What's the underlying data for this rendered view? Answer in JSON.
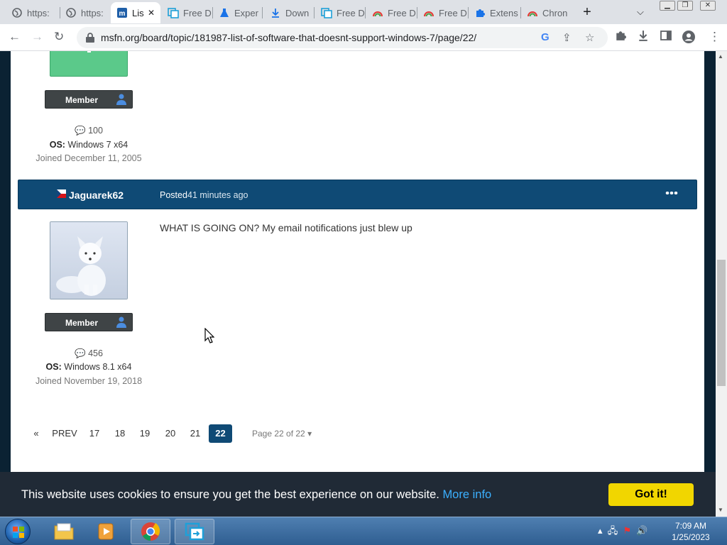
{
  "browser": {
    "tabs": [
      {
        "title": "https:",
        "icon": "globe-icon"
      },
      {
        "title": "https:",
        "icon": "globe-icon"
      },
      {
        "title": "Lis",
        "icon": "msfn-icon",
        "active": true
      },
      {
        "title": "Free D",
        "icon": "copy-icon"
      },
      {
        "title": "Exper",
        "icon": "flask-icon"
      },
      {
        "title": "Down",
        "icon": "download-icon"
      },
      {
        "title": "Free D",
        "icon": "copy-icon"
      },
      {
        "title": "Free D",
        "icon": "rainbow-icon"
      },
      {
        "title": "Free D",
        "icon": "rainbow-icon"
      },
      {
        "title": "Extens",
        "icon": "puzzle-icon"
      },
      {
        "title": "Chron",
        "icon": "rainbow-icon"
      }
    ],
    "url": "msfn.org/board/topic/181987-list-of-software-that-doesnt-support-windows-7/page/22/"
  },
  "prev_post": {
    "rank": "Member",
    "posts": "100",
    "os_label": "OS:",
    "os_value": "Windows 7 x64",
    "joined": "Joined December 11, 2005"
  },
  "post": {
    "author": "Jaguarek62",
    "posted_label": "Posted",
    "posted_time": "41 minutes ago",
    "content": "WHAT IS GOING ON? My email notifications just blew up",
    "rank": "Member",
    "posts": "456",
    "os_label": "OS:",
    "os_value": "Windows 8.1 x64",
    "joined": "Joined November 19, 2018"
  },
  "pagination": {
    "first": "«",
    "prev": "PREV",
    "pages": [
      "17",
      "18",
      "19",
      "20",
      "21",
      "22"
    ],
    "current": "22",
    "page_of": "Page 22 of 22"
  },
  "cookie": {
    "message": "This website uses cookies to ensure you get the best experience on our website.",
    "more_info": "More info",
    "accept": "Got it!"
  },
  "taskbar": {
    "time": "7:09 AM",
    "date": "1/25/2023"
  },
  "colors": {
    "post_header": "#0f4a75",
    "accept_button": "#f1d600",
    "link": "#3bb0ff"
  }
}
